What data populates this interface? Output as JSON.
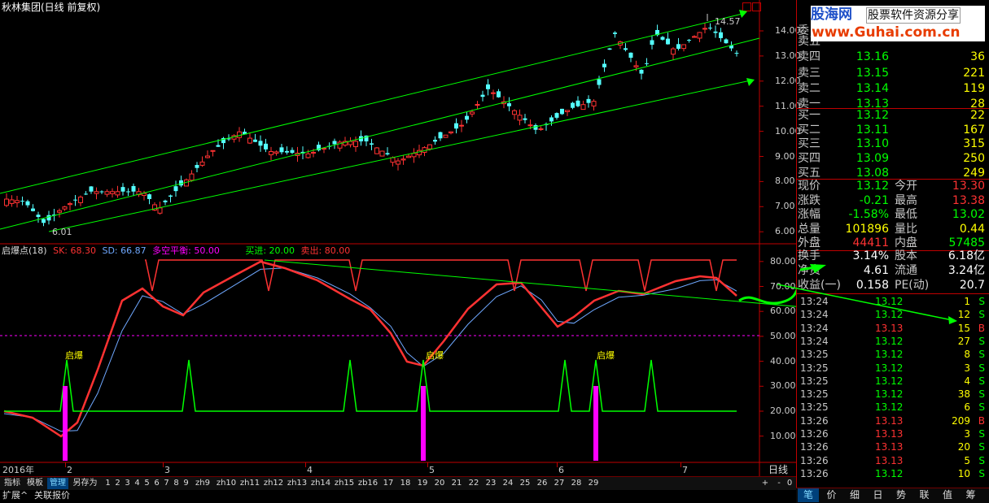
{
  "window": {
    "title": "秋林集团(日线 前复权)"
  },
  "watermark": {
    "brand": "股海网",
    "slogan": "股票软件资源分享",
    "url": "www.Guhai.com.cn"
  },
  "colors": {
    "up": "#ff3232",
    "down": "#54ffff",
    "green": "#00ff00",
    "grid": "#c00000",
    "yellow": "#ffff00",
    "magenta": "#ff00ff",
    "blue": "#6fa8ff"
  },
  "price_chart": {
    "y_ticks": [
      "14.00",
      "13.00",
      "12.00",
      "11.00",
      "10.00",
      "9.00",
      "8.00",
      "7.00",
      "6.00"
    ],
    "high_label": "14.57",
    "low_label": "6.01"
  },
  "indicator": {
    "name": "启爆点(18)",
    "sk_label": "SK: 68.30",
    "sd_label": "SD: 66.87",
    "balance_label": "多空平衡: 50.00",
    "buy_label": "买进: 20.00",
    "sell_label": "卖出: 80.00",
    "y_ticks": [
      "80.00",
      "70.00",
      "60.00",
      "50.00",
      "40.00",
      "30.00",
      "20.00",
      "10.00"
    ],
    "signal_label": "启爆"
  },
  "date_axis": {
    "year": "2016年",
    "months": [
      "2",
      "3",
      "4",
      "5",
      "6",
      "7"
    ],
    "period": "日线"
  },
  "bottom_toolbar": {
    "tabs": [
      "指标",
      "模板",
      "管理",
      "另存为"
    ],
    "nums": [
      "1",
      "2",
      "3",
      "4",
      "5",
      "6",
      "7",
      "8",
      "9",
      "zh9",
      "zh10",
      "zh11",
      "zh12",
      "zh13",
      "zh14",
      "zh15",
      "zb16",
      "17",
      "18",
      "19",
      "20",
      "21",
      "22",
      "23",
      "24",
      "25",
      "26",
      "27",
      "28",
      "29"
    ],
    "plus": "+",
    "minus": "-",
    "zero": "0"
  },
  "footer": {
    "expand": "扩展^",
    "related": "关联报价"
  },
  "quote": {
    "partial_label": "委",
    "asks": [
      {
        "label": "卖五",
        "price": "",
        "vol": ""
      },
      {
        "label": "卖四",
        "price": "13.16",
        "vol": "36"
      },
      {
        "label": "卖三",
        "price": "13.15",
        "vol": "221"
      },
      {
        "label": "卖二",
        "price": "13.14",
        "vol": "119"
      },
      {
        "label": "卖一",
        "price": "13.13",
        "vol": "28"
      }
    ],
    "bids": [
      {
        "label": "买一",
        "price": "13.12",
        "vol": "22"
      },
      {
        "label": "买二",
        "price": "13.11",
        "vol": "167"
      },
      {
        "label": "买三",
        "price": "13.10",
        "vol": "315"
      },
      {
        "label": "买四",
        "price": "13.09",
        "vol": "250"
      },
      {
        "label": "买五",
        "price": "13.08",
        "vol": "249"
      }
    ],
    "stats": [
      {
        "l1": "现价",
        "v1": "13.12",
        "c1": "#00ff00",
        "l2": "今开",
        "v2": "13.30",
        "c2": "#ff3232"
      },
      {
        "l1": "涨跌",
        "v1": "-0.21",
        "c1": "#00ff00",
        "l2": "最高",
        "v2": "13.38",
        "c2": "#ff3232"
      },
      {
        "l1": "涨幅",
        "v1": "-1.58%",
        "c1": "#00ff00",
        "l2": "最低",
        "v2": "13.02",
        "c2": "#00ff00"
      },
      {
        "l1": "总量",
        "v1": "101896",
        "c1": "#ffff00",
        "l2": "量比",
        "v2": "0.44",
        "c2": "#ffff00"
      },
      {
        "l1": "外盘",
        "v1": "44411",
        "c1": "#ff3232",
        "l2": "内盘",
        "v2": "57485",
        "c2": "#00ff00"
      }
    ],
    "extra": [
      {
        "l1": "换手",
        "v1": "3.14%",
        "l2": "股本",
        "v2": "6.18亿"
      },
      {
        "l1": "净资",
        "v1": "4.61",
        "l2": "流通",
        "v2": "3.24亿"
      },
      {
        "l1": "收益(一)",
        "v1": "0.158",
        "l2": "PE(动)",
        "v2": "20.7"
      }
    ]
  },
  "ticks": [
    {
      "time": "13:24",
      "price": "13.12",
      "vol": "1",
      "bs": "S"
    },
    {
      "time": "13:24",
      "price": "13.12",
      "vol": "12",
      "bs": "S"
    },
    {
      "time": "13:24",
      "price": "13.13",
      "vol": "15",
      "bs": "B"
    },
    {
      "time": "13:24",
      "price": "13.12",
      "vol": "27",
      "bs": "S"
    },
    {
      "time": "13:25",
      "price": "13.12",
      "vol": "8",
      "bs": "S"
    },
    {
      "time": "13:25",
      "price": "13.12",
      "vol": "3",
      "bs": "S"
    },
    {
      "time": "13:25",
      "price": "13.12",
      "vol": "4",
      "bs": "S"
    },
    {
      "time": "13:25",
      "price": "13.12",
      "vol": "38",
      "bs": "S"
    },
    {
      "time": "13:25",
      "price": "13.12",
      "vol": "6",
      "bs": "S"
    },
    {
      "time": "13:26",
      "price": "13.13",
      "vol": "209",
      "bs": "B"
    },
    {
      "time": "13:26",
      "price": "13.13",
      "vol": "3",
      "bs": "S"
    },
    {
      "time": "13:26",
      "price": "13.13",
      "vol": "20",
      "bs": "S"
    },
    {
      "time": "13:26",
      "price": "13.13",
      "vol": "5",
      "bs": "S"
    },
    {
      "time": "13:26",
      "price": "13.12",
      "vol": "10",
      "bs": "S"
    }
  ],
  "right_tabs": [
    "笔",
    "价",
    "细",
    "日",
    "势",
    "联",
    "值",
    "筹"
  ]
}
